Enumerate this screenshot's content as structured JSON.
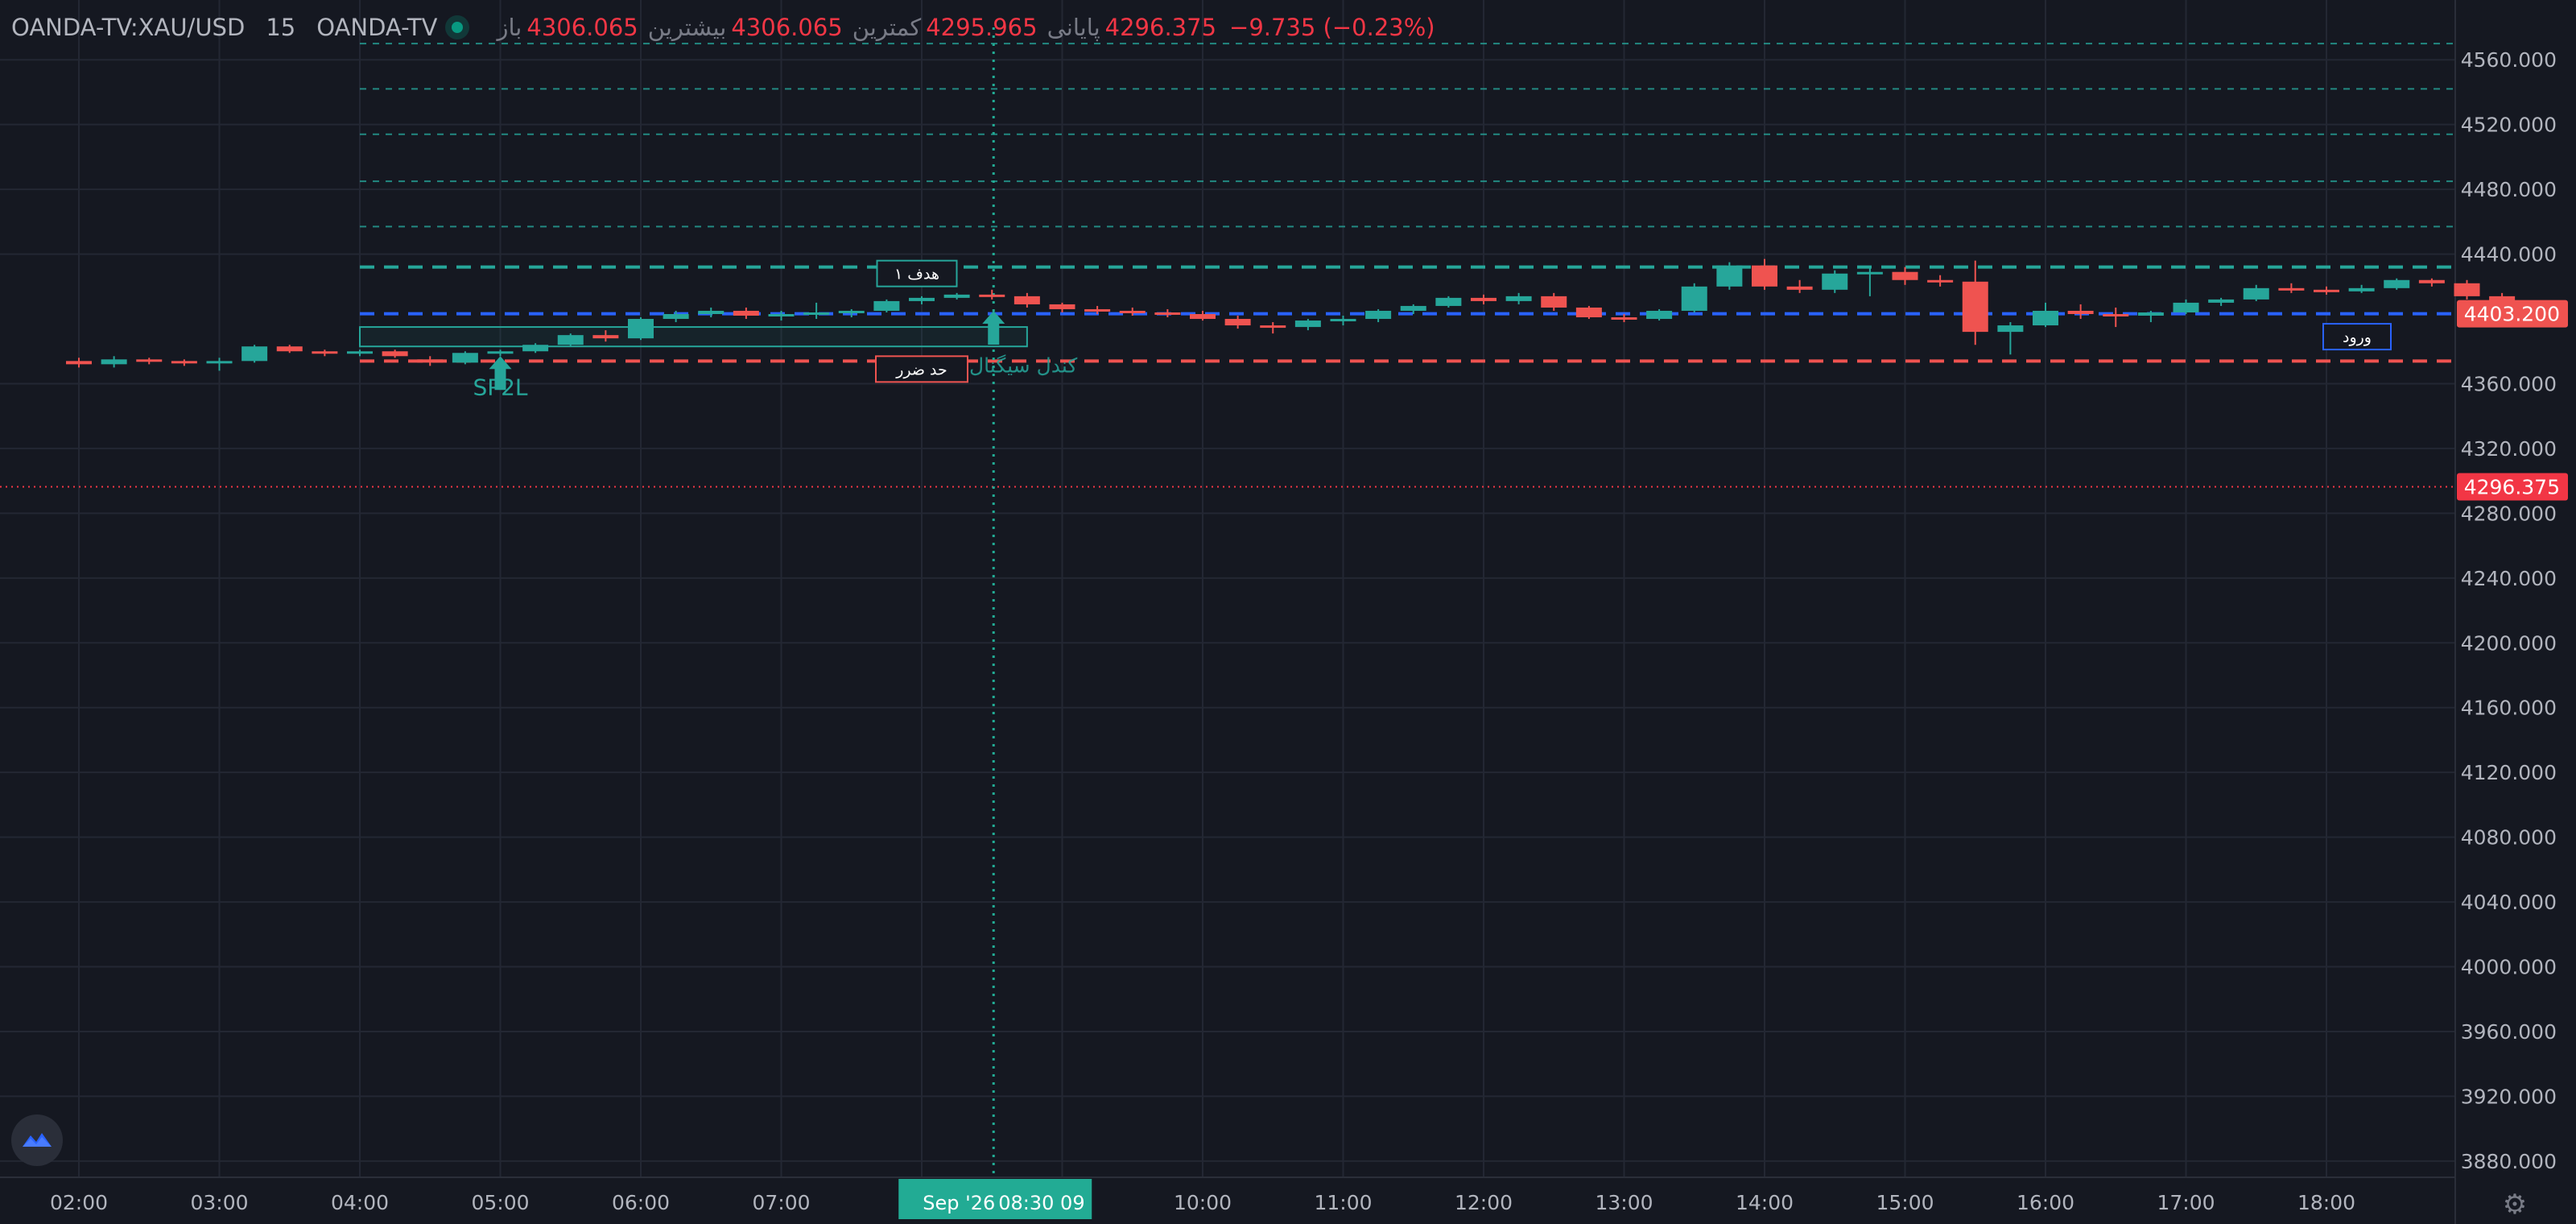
{
  "header": {
    "symbol": "OANDA-TV:XAU/USD",
    "interval": "15",
    "exchange": "OANDA-TV",
    "open_label": "باز",
    "open_value": "4306.065",
    "high_label": "بیشترین",
    "high_value": "4306.065",
    "low_label": "کمترین",
    "low_value": "4295.965",
    "close_label": "پایانی",
    "close_value": "4296.375",
    "change_value": "−9.735 (−0.23%)"
  },
  "colors": {
    "background": "#151821",
    "grid": "#232733",
    "up": "#26a69a",
    "down": "#ef5350",
    "entry_line": "#2962ff",
    "target_line": "#26a69a",
    "stop_line": "#ef5350",
    "last_price": "#f23645",
    "crosshair_label": "#22ab94"
  },
  "price_axis": {
    "labels": [
      "4560.000",
      "4520.000",
      "4480.000",
      "4440.000",
      "4403.200",
      "4360.000",
      "4320.000",
      "4296.375",
      "4280.000",
      "4240.000",
      "4200.000",
      "4160.000",
      "4120.000",
      "4080.000",
      "4040.000",
      "4000.000",
      "3960.000",
      "3920.000",
      "3880.000"
    ],
    "ticks": [
      4560,
      4520,
      4480,
      4440,
      4360,
      4320,
      4280,
      4240,
      4200,
      4160,
      4120,
      4080,
      4040,
      4000,
      3960,
      3920,
      3880
    ],
    "entry_price": 4403.2,
    "last_price": 4296.375
  },
  "time_axis": {
    "labels": [
      "02:00",
      "03:00",
      "04:00",
      "05:00",
      "06:00",
      "07:00",
      "10:00",
      "11:00",
      "12:00",
      "13:00",
      "14:00",
      "15:00",
      "16:00",
      "17:00",
      "18:00"
    ],
    "crosshair_date": "Sep '26",
    "crosshair_time": "08:30 09"
  },
  "annotations": {
    "target1": "هدف ۱",
    "stop": "حد ضرر",
    "entry": "ورود",
    "signal_candle": "کندل سیگنال",
    "pattern": "SP2L"
  },
  "levels": {
    "target_dashed": [
      4570,
      4542,
      4514,
      4485,
      4457
    ],
    "target1": 4432,
    "entry": 4403.2,
    "stop": 4374
  },
  "icons": {
    "logo": "tradingview-logo-icon",
    "settings": "settings-gear-icon",
    "status": "market-status-dot-icon",
    "arrows": "up-arrow-icon"
  },
  "chart_data": {
    "type": "candlestick",
    "symbol": "XAU/USD",
    "interval_minutes": 15,
    "ylim": [
      3870,
      4580
    ],
    "candles": [
      [
        0.0,
        4374,
        4376,
        4370,
        4372
      ],
      [
        0.25,
        4372,
        4377,
        4370,
        4375
      ],
      [
        0.5,
        4375,
        4376,
        4372,
        4374
      ],
      [
        0.75,
        4374,
        4375,
        4371,
        4373
      ],
      [
        1.0,
        4373,
        4376,
        4368,
        4374
      ],
      [
        1.25,
        4374,
        4384,
        4373,
        4383
      ],
      [
        1.5,
        4383,
        4384,
        4379,
        4380
      ],
      [
        1.75,
        4380,
        4381,
        4377,
        4379
      ],
      [
        2.0,
        4379,
        4381,
        4377,
        4380
      ],
      [
        2.25,
        4380,
        4381,
        4376,
        4377
      ],
      [
        2.5,
        4375,
        4377,
        4371,
        4373
      ],
      [
        2.75,
        4373,
        4380,
        4372,
        4379
      ],
      [
        3.0,
        4379,
        4381,
        4377,
        4380
      ],
      [
        3.25,
        4380,
        4385,
        4379,
        4384
      ],
      [
        3.5,
        4384,
        4391,
        4383,
        4390
      ],
      [
        3.75,
        4390,
        4393,
        4386,
        4388
      ],
      [
        4.0,
        4388,
        4401,
        4387,
        4400
      ],
      [
        4.25,
        4400,
        4405,
        4398,
        4403
      ],
      [
        4.5,
        4403,
        4407,
        4401,
        4405
      ],
      [
        4.75,
        4405,
        4407,
        4400,
        4402
      ],
      [
        5.0,
        4402,
        4405,
        4399,
        4403
      ],
      [
        5.25,
        4403,
        4410,
        4400,
        4404
      ],
      [
        5.5,
        4404,
        4406,
        4401,
        4405
      ],
      [
        5.75,
        4405,
        4412,
        4404,
        4411
      ],
      [
        6.0,
        4411,
        4414,
        4409,
        4413
      ],
      [
        6.25,
        4413,
        4416,
        4412,
        4415
      ],
      [
        6.5,
        4415,
        4418,
        4412,
        4414
      ],
      [
        6.75,
        4414,
        4416,
        4407,
        4409
      ],
      [
        7.0,
        4409,
        4410,
        4404,
        4406
      ],
      [
        7.25,
        4406,
        4408,
        4403,
        4405
      ],
      [
        7.5,
        4405,
        4407,
        4402,
        4404
      ],
      [
        7.75,
        4404,
        4406,
        4401,
        4403
      ],
      [
        8.0,
        4403,
        4405,
        4399,
        4400
      ],
      [
        8.25,
        4400,
        4402,
        4394,
        4396
      ],
      [
        8.5,
        4396,
        4398,
        4391,
        4395
      ],
      [
        8.75,
        4395,
        4400,
        4393,
        4399
      ],
      [
        9.0,
        4399,
        4402,
        4396,
        4400
      ],
      [
        9.25,
        4400,
        4406,
        4398,
        4405
      ],
      [
        9.5,
        4405,
        4409,
        4403,
        4408
      ],
      [
        9.75,
        4408,
        4414,
        4407,
        4413
      ],
      [
        10.0,
        4413,
        4415,
        4409,
        4411
      ],
      [
        10.25,
        4411,
        4416,
        4409,
        4414
      ],
      [
        10.5,
        4414,
        4416,
        4405,
        4407
      ],
      [
        10.75,
        4407,
        4408,
        4400,
        4401
      ],
      [
        11.0,
        4401,
        4403,
        4398,
        4400
      ],
      [
        11.25,
        4400,
        4406,
        4399,
        4405
      ],
      [
        11.5,
        4405,
        4422,
        4404,
        4420
      ],
      [
        11.75,
        4420,
        4435,
        4418,
        4433
      ],
      [
        12.0,
        4433,
        4437,
        4418,
        4420
      ],
      [
        12.25,
        4420,
        4424,
        4416,
        4418
      ],
      [
        12.5,
        4418,
        4430,
        4416,
        4428
      ],
      [
        12.75,
        4428,
        4432,
        4414,
        4429
      ],
      [
        13.0,
        4429,
        4432,
        4421,
        4424
      ],
      [
        13.25,
        4424,
        4427,
        4420,
        4423
      ],
      [
        13.5,
        4423,
        4436,
        4384,
        4392
      ],
      [
        13.75,
        4392,
        4398,
        4378,
        4396
      ],
      [
        14.0,
        4396,
        4410,
        4395,
        4405
      ],
      [
        14.25,
        4405,
        4409,
        4400,
        4403
      ],
      [
        14.5,
        4403,
        4407,
        4395,
        4402
      ],
      [
        14.75,
        4402,
        4405,
        4398,
        4404
      ],
      [
        15.0,
        4404,
        4412,
        4403,
        4410
      ],
      [
        15.25,
        4410,
        4413,
        4408,
        4412
      ],
      [
        15.5,
        4412,
        4421,
        4411,
        4419
      ],
      [
        15.75,
        4419,
        4422,
        4416,
        4418
      ],
      [
        16.0,
        4418,
        4420,
        4415,
        4417
      ],
      [
        16.25,
        4417,
        4421,
        4416,
        4419
      ],
      [
        16.5,
        4419,
        4425,
        4418,
        4424
      ],
      [
        16.75,
        4424,
        4425,
        4420,
        4422
      ],
      [
        17.0,
        4422,
        4424,
        4412,
        4414
      ],
      [
        17.25,
        4414,
        4416,
        4406,
        4408
      ]
    ]
  }
}
